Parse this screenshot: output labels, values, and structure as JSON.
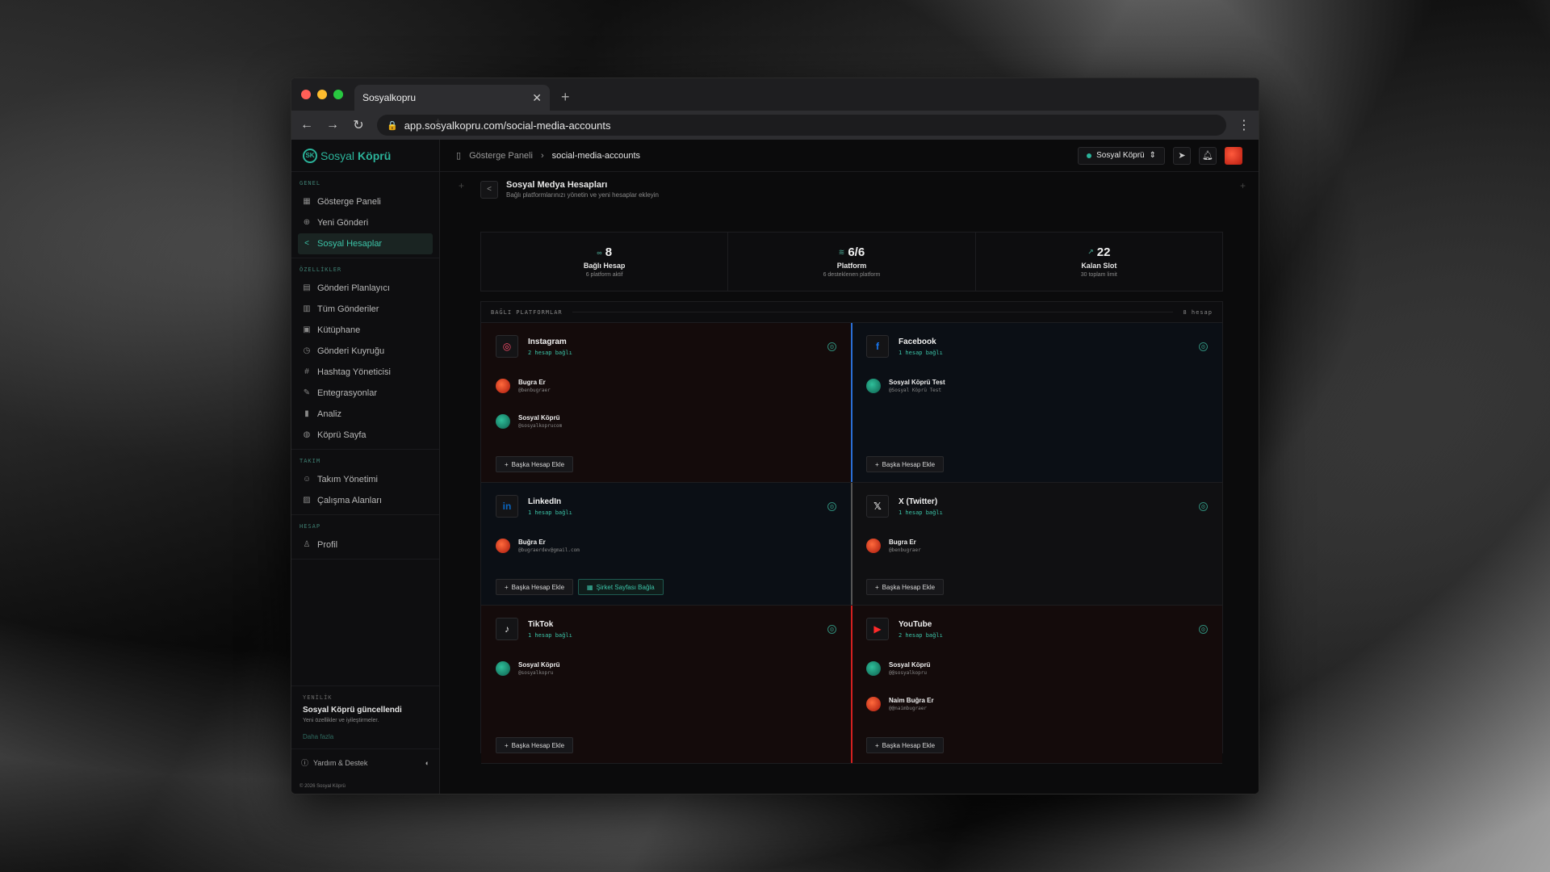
{
  "browser": {
    "tab_title": "Sosyalkopru",
    "url": "app.sosyalkopru.com/social-media-accounts",
    "traffic_colors": [
      "#ff5f57",
      "#febc2e",
      "#28c840"
    ]
  },
  "sidebar": {
    "logo_a": "Sosyal",
    "logo_b": "Köprü",
    "sections": [
      {
        "title": "GENEL",
        "items": [
          {
            "label": "Gösterge Paneli",
            "icon": "grid-icon"
          },
          {
            "label": "Yeni Gönderi",
            "icon": "plus-circle-icon"
          },
          {
            "label": "Sosyal Hesaplar",
            "icon": "share-icon",
            "active": true
          }
        ]
      },
      {
        "title": "ÖZELLİKLER",
        "items": [
          {
            "label": "Gönderi Planlayıcı",
            "icon": "calendar-icon"
          },
          {
            "label": "Tüm Gönderiler",
            "icon": "file-icon"
          },
          {
            "label": "Kütüphane",
            "icon": "library-icon"
          },
          {
            "label": "Gönderi Kuyruğu",
            "icon": "clock-icon"
          },
          {
            "label": "Hashtag Yöneticisi",
            "icon": "hashtag-icon"
          },
          {
            "label": "Entegrasyonlar",
            "icon": "puzzle-icon"
          },
          {
            "label": "Analiz",
            "icon": "chart-icon"
          },
          {
            "label": "Köprü Sayfa",
            "icon": "globe-icon"
          }
        ]
      },
      {
        "title": "TAKIM",
        "items": [
          {
            "label": "Takım Yönetimi",
            "icon": "users-icon"
          },
          {
            "label": "Çalışma Alanları",
            "icon": "briefcase-icon"
          }
        ]
      },
      {
        "title": "HESAP",
        "items": [
          {
            "label": "Profil",
            "icon": "user-icon"
          }
        ]
      }
    ],
    "news": {
      "tag": "YENİLİK",
      "title": "Sosyal Köprü güncellendi",
      "sub": "Yeni özellikler ve iyileştirmeler.",
      "more": "Daha fazla"
    },
    "help_label": "Yardım & Destek",
    "copyright": "© 2026 Sosyal Köprü"
  },
  "topbar": {
    "crumb_root": "Gösterge Paneli",
    "crumb_current": "social-media-accounts",
    "workspace": "Sosyal Köprü"
  },
  "page": {
    "title": "Sosyal Medya Hesapları",
    "subtitle": "Bağlı platformlarınızı yönetin ve yeni hesaplar ekleyin"
  },
  "stats": [
    {
      "value": "8",
      "label": "Bağlı Hesap",
      "sub": "6 platform aktif"
    },
    {
      "value": "6/6",
      "label": "Platform",
      "sub": "6 desteklenen platform"
    },
    {
      "value": "22",
      "label": "Kalan Slot",
      "sub": "30 toplam limit"
    }
  ],
  "platforms_section": {
    "title": "BAĞLI PLATFORMLAR",
    "count": "8 hesap",
    "add_label": "Başka Hesap Ekle",
    "company_label": "Şirket Sayfası Bağla"
  },
  "platforms": [
    {
      "name": "Instagram",
      "count": "2 hesap bağlı",
      "accounts": [
        {
          "name": "Bugra Er",
          "handle": "@benbugraer",
          "av": "red"
        },
        {
          "name": "Sosyal Köprü",
          "handle": "@sosyalkoprucom",
          "av": "green"
        }
      ]
    },
    {
      "name": "Facebook",
      "count": "1 hesap bağlı",
      "accounts": [
        {
          "name": "Sosyal Köprü Test",
          "handle": "@Sosyal Köprü Test",
          "av": "green"
        }
      ]
    },
    {
      "name": "LinkedIn",
      "count": "1 hesap bağlı",
      "accounts": [
        {
          "name": "Buğra Er",
          "handle": "@bugraerdev@gmail.com",
          "av": "red"
        }
      ]
    },
    {
      "name": "X (Twitter)",
      "count": "1 hesap bağlı",
      "accounts": [
        {
          "name": "Bugra Er",
          "handle": "@benbugraer",
          "av": "red"
        }
      ]
    },
    {
      "name": "TikTok",
      "count": "1 hesap bağlı",
      "accounts": [
        {
          "name": "Sosyal Köprü",
          "handle": "@sosyalkopru",
          "av": "green"
        }
      ]
    },
    {
      "name": "YouTube",
      "count": "2 hesap bağlı",
      "accounts": [
        {
          "name": "Sosyal Köprü",
          "handle": "@@sosyalkopru",
          "av": "green"
        },
        {
          "name": "Naim Buğra Er",
          "handle": "@@naimbugraer",
          "av": "red"
        }
      ]
    }
  ]
}
